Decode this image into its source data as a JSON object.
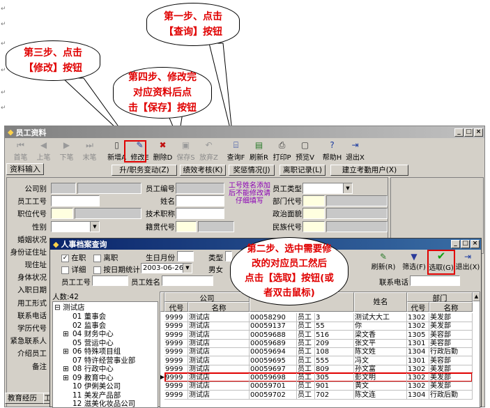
{
  "callouts": {
    "step1": [
      "第一步、点击",
      "【查询】按钮"
    ],
    "step3": [
      "第三步、点击",
      "【修改】按钮"
    ],
    "step4": [
      "第四步、修改完",
      "对应资料后点",
      "击【保存】按钮"
    ],
    "step2": [
      "第二步、选中需要修",
      "改的对应员工然后",
      "点击【选取】按钮(或",
      "者双击鼠标)"
    ]
  },
  "main_window": {
    "title": "员工资料",
    "toolbar": [
      {
        "label": "首笔",
        "icon": "first-icon",
        "enabled": false
      },
      {
        "label": "上笔",
        "icon": "prev-icon",
        "enabled": false
      },
      {
        "label": "下笔",
        "icon": "next-icon",
        "enabled": false
      },
      {
        "label": "末笔",
        "icon": "last-icon",
        "enabled": false
      },
      {
        "label": "新增A",
        "icon": "new-doc-icon",
        "enabled": true
      },
      {
        "label": "修改E",
        "icon": "edit-icon",
        "enabled": true
      },
      {
        "label": "删除D",
        "icon": "delete-icon",
        "enabled": true
      },
      {
        "label": "保存S",
        "icon": "save-icon",
        "enabled": false
      },
      {
        "label": "放弃Z",
        "icon": "undo-icon",
        "enabled": false
      },
      {
        "label": "查询F",
        "icon": "query-icon",
        "enabled": true
      },
      {
        "label": "刷新R",
        "icon": "refresh-icon",
        "enabled": true
      },
      {
        "label": "打印P",
        "icon": "print-icon",
        "enabled": true
      },
      {
        "label": "预览V",
        "icon": "preview-icon",
        "enabled": true
      },
      {
        "label": "帮助H",
        "icon": "help-icon",
        "enabled": true
      },
      {
        "label": "退出X",
        "icon": "exit-icon",
        "enabled": true
      }
    ],
    "tab_input": "资料输入",
    "action_buttons": [
      "升/职务变动(Z)",
      "绩效考核(K)",
      "奖惩情况(J)",
      "离职记录(L)",
      "建立考勤用户(X)"
    ],
    "form_labels": {
      "company": "公司别",
      "emp_no": "员工工号",
      "position": "职位代号",
      "gender": "性别",
      "marital": "婚姻状况",
      "id_addr": "身份证住址",
      "current_addr": "现住址",
      "id_status": "身体状况",
      "join_date": "入职日期",
      "work_type": "用工形式",
      "contact_phone": "联系电话",
      "education": "学历代号",
      "emergency": "紧急联系人",
      "referrer": "介绍员工",
      "note": "备注",
      "emp_code": "员工编号",
      "name": "姓名",
      "tech_title": "技术职称",
      "native_code": "籍贯代号",
      "emp_type": "员工类型",
      "dept_code": "部门代号",
      "political": "政治面貌",
      "ethnic": "民族代号"
    },
    "name_hint": "工号姓名添加后不能修改请仔细填写",
    "bottom_tabs": [
      "教育经历",
      "工"
    ]
  },
  "dialog": {
    "title": "人事档案查询",
    "radio_active": "在职",
    "radio_left": "离职",
    "detail": "详细",
    "by_date": "按日期统计",
    "birth_month_label": "生日月份",
    "date_value": "2003-06-26",
    "type_label": "类型",
    "gender_male": "男女",
    "emp_no_label": "员工工号",
    "emp_name_label": "员工姓名",
    "phone_label": "联系电话",
    "refresh_btn": "刷新(R)",
    "filter_btn": "筛选(F)",
    "select_btn": "选取(G)",
    "exit_btn": "退出(X)",
    "count_label": "人数:42",
    "tree": {
      "root": "测试店",
      "items": [
        {
          "text": "01 董事会",
          "expand": false
        },
        {
          "text": "02 监事会",
          "expand": false
        },
        {
          "text": "04 财务中心",
          "expand": true
        },
        {
          "text": "05 营运中心",
          "expand": false
        },
        {
          "text": "06 特殊项目组",
          "expand": true
        },
        {
          "text": "07 特许经营事业部",
          "expand": false
        },
        {
          "text": "08 行政中心",
          "expand": true
        },
        {
          "text": "09 教育中心",
          "expand": true
        },
        {
          "text": "10 伊俐美公司",
          "expand": false
        },
        {
          "text": "11 美发产品部",
          "expand": false
        },
        {
          "text": "12 滋美化妆品公司",
          "expand": false
        }
      ]
    },
    "grid": {
      "group_company": "公司",
      "group_dept": "部门",
      "col_code": "代号",
      "col_name": "名称",
      "col_emp_name": "姓名",
      "col_dept_code": "代号",
      "col_dept_name": "名称",
      "rows": [
        {
          "code": "9999",
          "company": "测试店",
          "id": "00058290",
          "type": "员工",
          "no": "3",
          "name": "测试大大工",
          "dcode": "1302",
          "dname": "美发部",
          "selected": false
        },
        {
          "code": "9999",
          "company": "测试店",
          "id": "00059137",
          "type": "员工",
          "no": "55",
          "name": "你",
          "dcode": "1302",
          "dname": "美发部",
          "selected": false
        },
        {
          "code": "9999",
          "company": "测试店",
          "id": "00059688",
          "type": "员工",
          "no": "516",
          "name": "梁文香",
          "dcode": "1305",
          "dname": "美容部",
          "selected": false
        },
        {
          "code": "9999",
          "company": "测试店",
          "id": "00059689",
          "type": "员工",
          "no": "209",
          "name": "张文平",
          "dcode": "1301",
          "dname": "美容部",
          "selected": false
        },
        {
          "code": "9999",
          "company": "测试店",
          "id": "00059694",
          "type": "员工",
          "no": "108",
          "name": "陈文姓",
          "dcode": "1304",
          "dname": "行政后勤",
          "selected": false
        },
        {
          "code": "9999",
          "company": "测试店",
          "id": "00059695",
          "type": "员工",
          "no": "555",
          "name": "冯文",
          "dcode": "1301",
          "dname": "美容部",
          "selected": false
        },
        {
          "code": "9999",
          "company": "测试店",
          "id": "00059697",
          "type": "员工",
          "no": "809",
          "name": "孙文富",
          "dcode": "1302",
          "dname": "美发部",
          "selected": false
        },
        {
          "code": "9999",
          "company": "测试店",
          "id": "00059698",
          "type": "员工",
          "no": "305",
          "name": "彭文明",
          "dcode": "1302",
          "dname": "美发部",
          "selected": true
        },
        {
          "code": "9999",
          "company": "测试店",
          "id": "00059701",
          "type": "员工",
          "no": "901",
          "name": "黄文",
          "dcode": "1302",
          "dname": "美发部",
          "selected": false
        },
        {
          "code": "9999",
          "company": "测试店",
          "id": "00059702",
          "type": "员工",
          "no": "702",
          "name": "陈文连",
          "dcode": "1304",
          "dname": "行政后勤",
          "selected": false
        }
      ]
    }
  },
  "colors": {
    "callout_text": "#e00000",
    "highlight": "#e00000",
    "window": "#d4d0c8",
    "dialog_title": "#0a246a"
  }
}
